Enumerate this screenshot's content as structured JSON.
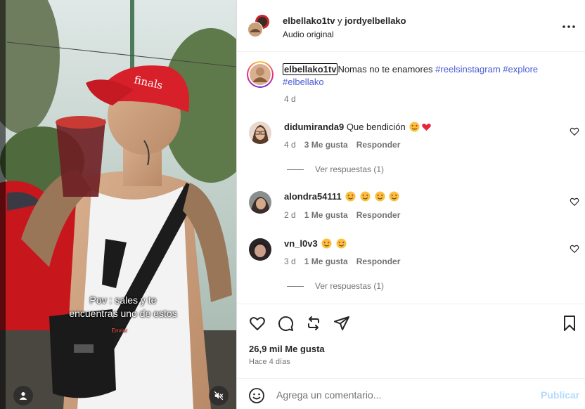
{
  "video": {
    "caption_line1": "Pov : sales  y te",
    "caption_line2": "encuentras uno de estos",
    "caption_sub": "Enviar",
    "icons": {
      "user": "user-icon",
      "mute": "speaker-muted-icon"
    }
  },
  "header": {
    "user1": "elbellako1tv",
    "joiner": " y ",
    "user2": "jordyelbellako",
    "audio": "Audio original",
    "more_icon": "more-horizontal-icon"
  },
  "post_caption": {
    "username": "elbellako1tv",
    "text": "Nomas no te enamores ",
    "tags": [
      "#reelsinstagram",
      "#explore",
      "#elbellako"
    ],
    "time": "4 d"
  },
  "comments": [
    {
      "user": "didumiranda9",
      "text": "Que bendición",
      "emojis": [
        "heart-eyes",
        "red-heart"
      ],
      "time": "4 d",
      "likes": "3 Me gusta",
      "reply": "Responder",
      "view_replies": "Ver respuestas (1)"
    },
    {
      "user": "alondra54111",
      "text": "",
      "emojis": [
        "heart-eyes",
        "heart-eyes",
        "heart-eyes",
        "heart-eyes"
      ],
      "time": "2 d",
      "likes": "1 Me gusta",
      "reply": "Responder",
      "view_replies": ""
    },
    {
      "user": "vn_l0v3",
      "text": "",
      "emojis": [
        "heart-eyes",
        "heart-eyes"
      ],
      "time": "3 d",
      "likes": "1 Me gusta",
      "reply": "Responder",
      "view_replies": "Ver respuestas (1)"
    }
  ],
  "actions": {
    "icons": [
      "heart-icon",
      "comment-icon",
      "repost-icon",
      "share-icon",
      "bookmark-icon"
    ],
    "likes": "26,9 mil Me gusta",
    "posted": "Hace 4 días"
  },
  "composer": {
    "placeholder": "Agrega un comentario...",
    "post_label": "Publicar"
  },
  "colors": {
    "link": "#4a5cd6",
    "muted": "#737373",
    "post_disabled": "#b3dbff"
  }
}
